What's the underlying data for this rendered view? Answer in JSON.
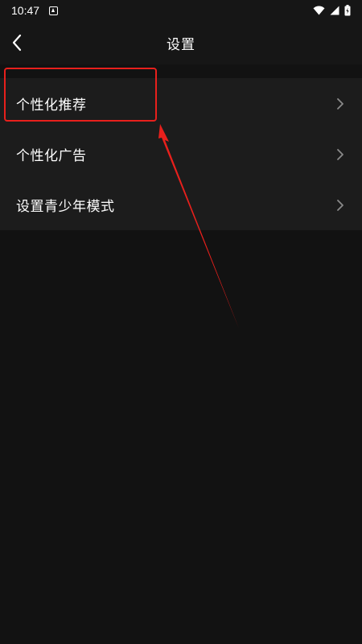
{
  "status_bar": {
    "time": "10:47"
  },
  "header": {
    "title": "设置"
  },
  "settings": {
    "items": [
      {
        "label": "个性化推荐"
      },
      {
        "label": "个性化广告"
      },
      {
        "label": "设置青少年模式"
      }
    ]
  },
  "colors": {
    "background": "#121212",
    "bar": "#161616",
    "list_bg": "#1c1c1c",
    "annotation": "#e8201c"
  }
}
